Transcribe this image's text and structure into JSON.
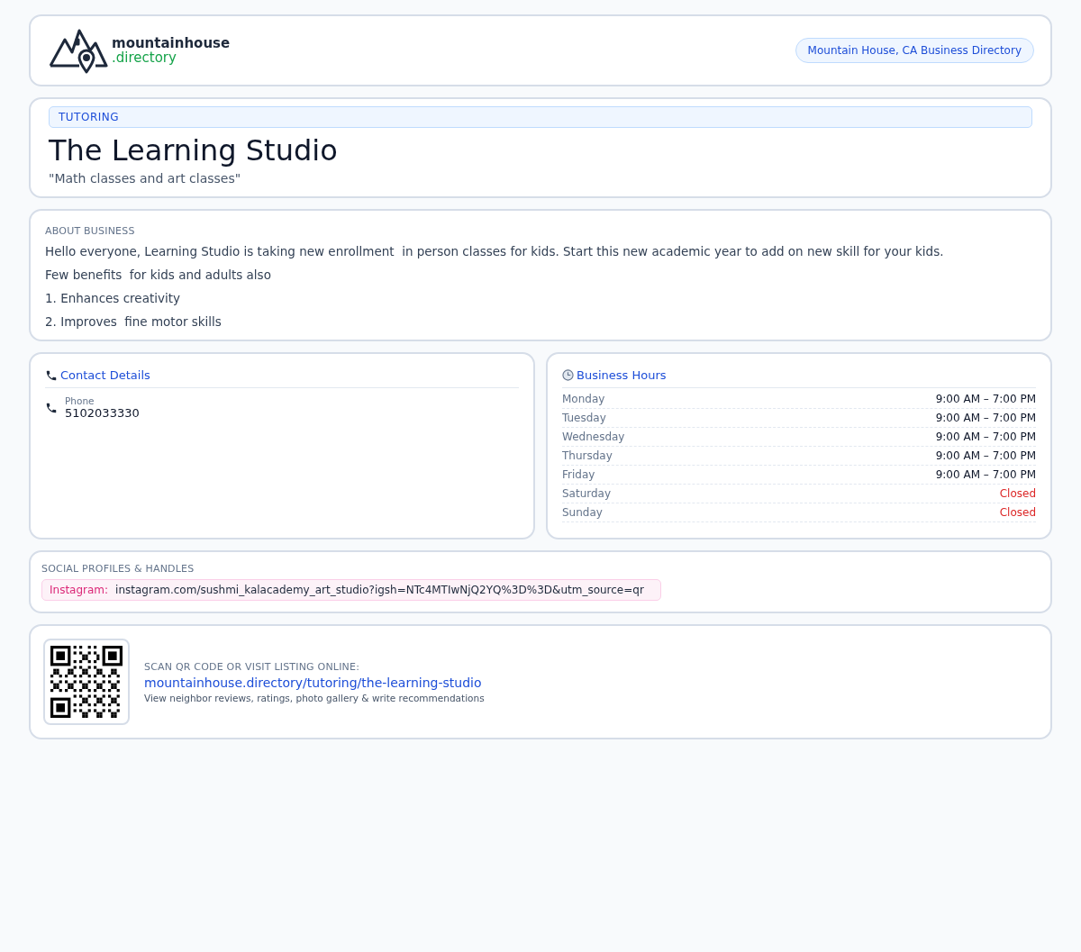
{
  "header": {
    "logo": {
      "name": "mountainhouse",
      "suffix": ".directory"
    },
    "badge": "Mountain House, CA Business Directory"
  },
  "listing": {
    "category": "TUTORING",
    "title": "The Learning Studio",
    "tagline": "\"Math classes and art classes\""
  },
  "about": {
    "heading": "ABOUT BUSINESS",
    "paragraphs": [
      "Hello everyone, Learning Studio is taking new enrollment  in person classes for kids. Start this new academic year to add on new skill for your kids.",
      "Few benefits  for kids and adults also",
      "1. Enhances creativity",
      "2. Improves  fine motor skills"
    ]
  },
  "contact": {
    "heading": "Contact Details",
    "items": [
      {
        "label": "Phone",
        "value": "5102033330"
      }
    ]
  },
  "hours": {
    "heading": "Business Hours",
    "days": [
      {
        "day": "Monday",
        "hours": "9:00 AM – 7:00 PM",
        "closed": false
      },
      {
        "day": "Tuesday",
        "hours": "9:00 AM – 7:00 PM",
        "closed": false
      },
      {
        "day": "Wednesday",
        "hours": "9:00 AM – 7:00 PM",
        "closed": false
      },
      {
        "day": "Thursday",
        "hours": "9:00 AM – 7:00 PM",
        "closed": false
      },
      {
        "day": "Friday",
        "hours": "9:00 AM – 7:00 PM",
        "closed": false
      },
      {
        "day": "Saturday",
        "hours": "Closed",
        "closed": true
      },
      {
        "day": "Sunday",
        "hours": "Closed",
        "closed": true
      }
    ]
  },
  "social": {
    "heading": "SOCIAL PROFILES & HANDLES",
    "profiles": [
      {
        "network": "Instagram:",
        "handle": "instagram.com/sushmi_kalacademy_art_studio?igsh=NTc4MTIwNjQ2YQ%3D%3D&utm_source=qr"
      }
    ]
  },
  "qr": {
    "heading": "SCAN QR CODE OR VISIT LISTING ONLINE:",
    "url": "mountainhouse.directory/tutoring/the-learning-studio",
    "note": "View neighbor reviews, ratings, photo gallery & write recommendations"
  }
}
